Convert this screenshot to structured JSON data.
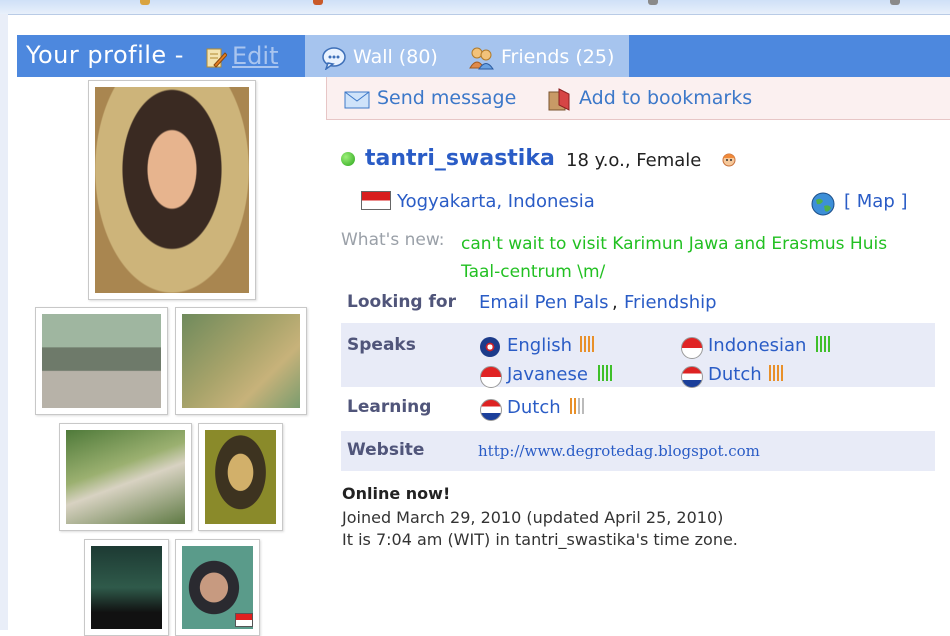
{
  "header": {
    "title": "Your profile - ",
    "edit_label": "Edit",
    "tabs": [
      {
        "label": "Wall (80)",
        "icon": "speech-bubble-icon"
      },
      {
        "label": "Friends (25)",
        "icon": "people-icon"
      }
    ]
  },
  "actions": {
    "send_message": "Send message",
    "add_bookmarks": "Add to bookmarks"
  },
  "profile": {
    "username": "tantri_swastika",
    "age_sex": "18 y.o., Female",
    "location": "Yogyakarta, Indonesia",
    "map_open": "[",
    "map_label": "Map",
    "map_close": "]",
    "whats_new_label": "What's new:",
    "whats_new_text": "can't wait to visit Karimun Jawa and Erasmus Huis Taal-centrum \\m/",
    "looking_for_label": "Looking for",
    "looking_for_1": "Email Pen Pals",
    "looking_for_sep": ",",
    "looking_for_2": "Friendship",
    "speaks_label": "Speaks",
    "speaks": [
      {
        "name": "English",
        "level_bars": 4,
        "level_filled": 4,
        "level_color": "#e8902a"
      },
      {
        "name": "Indonesian",
        "level_bars": 4,
        "level_filled": 4,
        "level_color": "#3fbf2a"
      },
      {
        "name": "Javanese",
        "level_bars": 4,
        "level_filled": 4,
        "level_color": "#3fbf2a"
      },
      {
        "name": "Dutch",
        "level_bars": 4,
        "level_filled": 4,
        "level_color": "#e8902a"
      }
    ],
    "learning_label": "Learning",
    "learning": [
      {
        "name": "Dutch",
        "level_bars": 4,
        "level_filled": 2,
        "level_color": "#e8902a"
      }
    ],
    "website_label": "Website",
    "website": "http://www.degrotedag.blogspot.com",
    "online_now": "Online now!",
    "joined": "Joined March 29, 2010 (updated April 25, 2010)",
    "timezone": "It is 7:04 am (WIT) in tantri_swastika's time zone."
  },
  "colors": {
    "header_bg": "#4d88de",
    "tabs_bg": "#a6c4ee",
    "link": "#2a5cc6",
    "whats_new": "#22c022",
    "row_bg": "#e8ebf7"
  }
}
